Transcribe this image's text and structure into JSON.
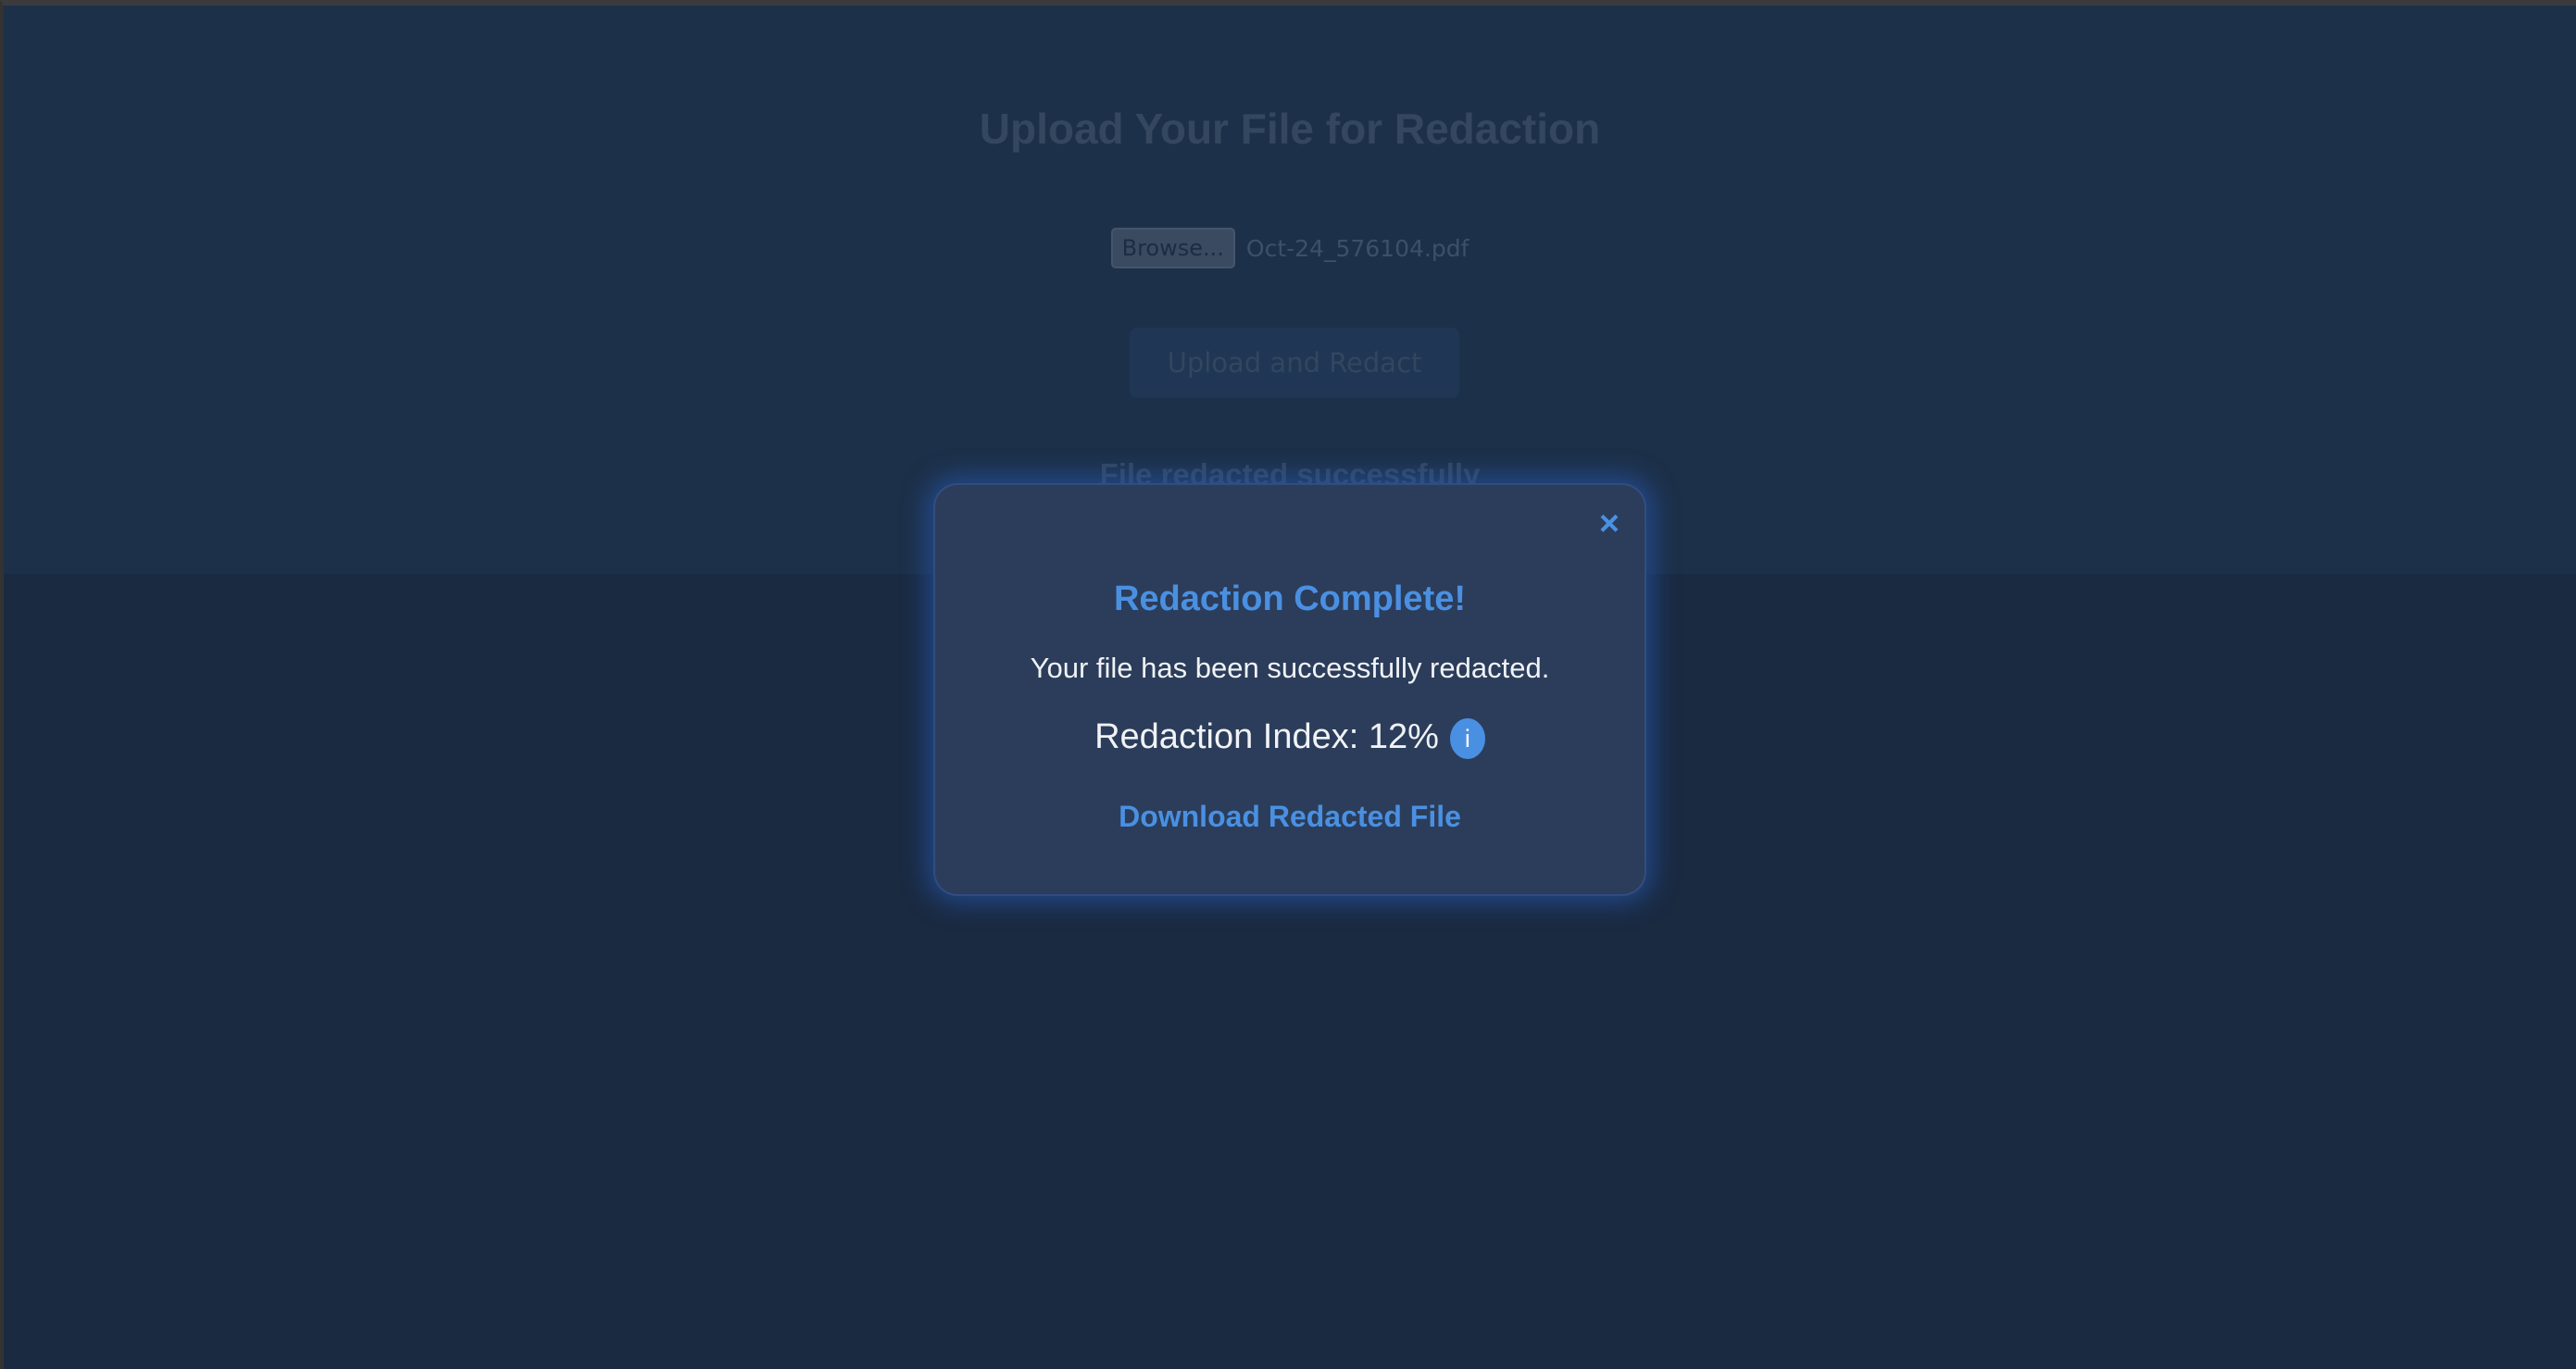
{
  "upload_page": {
    "title": "Upload Your File for Redaction",
    "browse_label": "Browse...",
    "selected_file": "Oct-24_576104.pdf",
    "upload_button_label": "Upload and Redact",
    "status_message": "File redacted successfully"
  },
  "modal": {
    "close_symbol": "×",
    "title": "Redaction Complete!",
    "message": "Your file has been successfully redacted.",
    "index_text": "Redaction Index: 12%",
    "info_symbol": "i",
    "download_label": "Download Redacted File"
  },
  "colors": {
    "accent": "#4a90e2",
    "page_background": "#1a2a41",
    "modal_background": "#2b3d5a",
    "modal_text": "#f0f2f5"
  }
}
